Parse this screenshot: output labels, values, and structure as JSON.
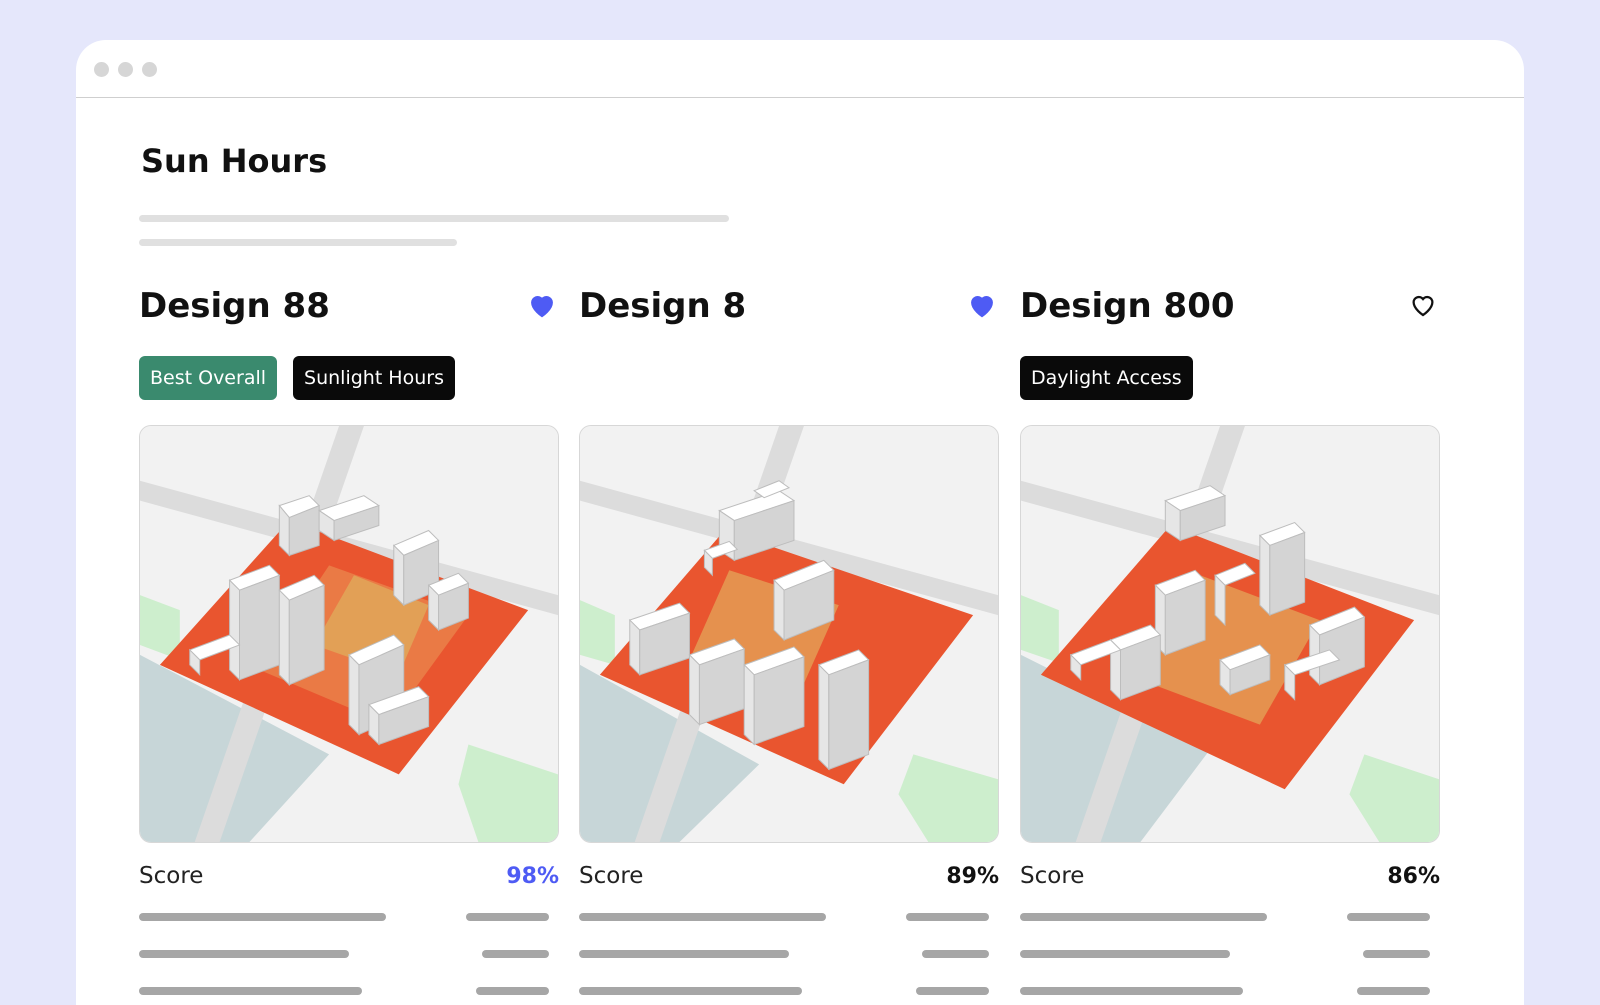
{
  "page": {
    "title": "Sun Hours"
  },
  "cards": [
    {
      "title": "Design 88",
      "favorite": true,
      "tags": [
        {
          "label": "Best Overall",
          "color": "#3a8a6e"
        },
        {
          "label": "Sunlight Hours",
          "color": "#0a0a0a"
        }
      ],
      "score_label": "Score",
      "score": "98%",
      "score_color": "#4e5bf4"
    },
    {
      "title": "Design 8",
      "favorite": true,
      "tags": [],
      "score_label": "Score",
      "score": "89%",
      "score_color": "#111111"
    },
    {
      "title": "Design 800",
      "favorite": false,
      "tags": [
        {
          "label": "Daylight Access",
          "color": "#0a0a0a"
        }
      ],
      "score_label": "Score",
      "score": "86%",
      "score_color": "#111111"
    }
  ],
  "icons": {
    "favorite": "heart-icon"
  },
  "colors": {
    "background": "#e5e7fb",
    "heart_filled": "#4e5bf4",
    "heatmap": "#e9552f",
    "water": "#c6d6d8",
    "park": "#cdeecd"
  }
}
